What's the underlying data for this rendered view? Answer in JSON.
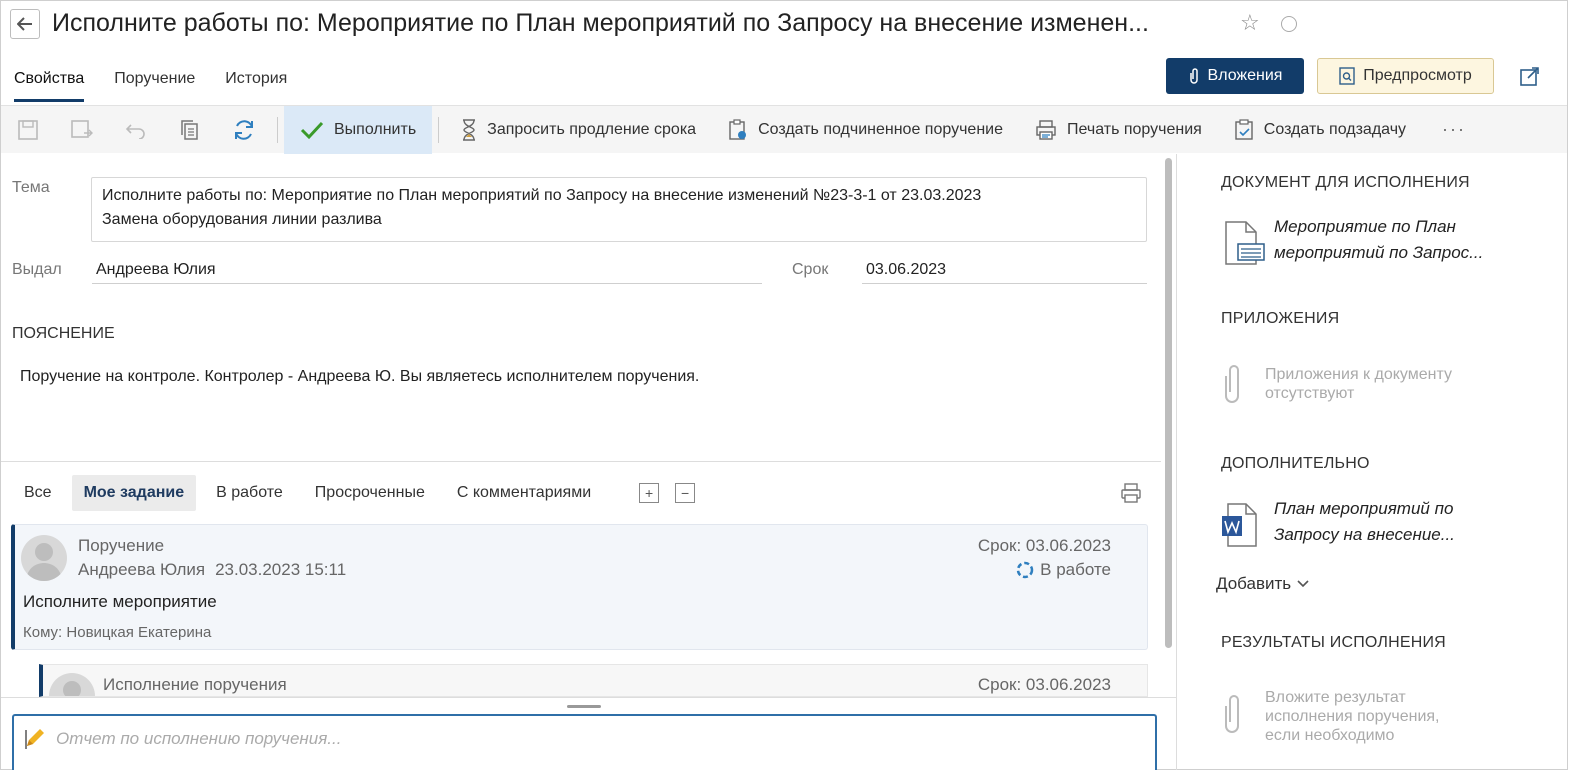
{
  "window": {
    "title": "Исполните работы по: Мероприятие по План мероприятий по Запросу на внесение изменен..."
  },
  "tabs": [
    {
      "label": "Свойства",
      "active": true
    },
    {
      "label": "Поручение",
      "active": false
    },
    {
      "label": "История",
      "active": false
    }
  ],
  "header_buttons": {
    "attachments": "Вложения",
    "preview": "Предпросмотр"
  },
  "toolbar": {
    "execute": "Выполнить",
    "request_extension": "Запросить продление срока",
    "create_sub_assignment": "Создать подчиненное поручение",
    "print_assignment": "Печать поручения",
    "create_subtask": "Создать подзадачу",
    "more": "···"
  },
  "form": {
    "theme_label": "Тема",
    "theme_line1": "Исполните работы по: Мероприятие по План мероприятий по Запросу на внесение изменений №23-3-1 от 23.03.2023",
    "theme_line2": "Замена оборудования линии разлива",
    "issued_label": "Выдал",
    "issued_value": "Андреева Юлия",
    "deadline_label": "Срок",
    "deadline_value": "03.06.2023",
    "explanation_header": "ПОЯСНЕНИЕ",
    "explanation_text": "Поручение на контроле. Контролер - Андреева Ю. Вы являетесь исполнителем поручения."
  },
  "filters": [
    {
      "label": "Все",
      "active": false
    },
    {
      "label": "Мое задание",
      "active": true
    },
    {
      "label": "В работе",
      "active": false
    },
    {
      "label": "Просроченные",
      "active": false
    },
    {
      "label": "С комментариями",
      "active": false
    }
  ],
  "expand_symbols": {
    "plus": "+",
    "minus": "−"
  },
  "cards": [
    {
      "type": "Поручение",
      "author": "Андреева Юлия",
      "date": "23.03.2023 15:11",
      "due": "Срок: 03.06.2023",
      "status": "В работе",
      "text": "Исполните мероприятие",
      "to": "Кому: Новицкая Екатерина"
    },
    {
      "type": "Исполнение поручения",
      "due": "Срок: 03.06.2023"
    }
  ],
  "report": {
    "placeholder": "Отчет по исполнению поручения..."
  },
  "right_panel": {
    "doc_header": "ДОКУМЕНТ ДЛЯ ИСПОЛНЕНИЯ",
    "doc_line1": "Мероприятие по План",
    "doc_line2": "мероприятий по Запрос...",
    "attachments_header": "ПРИЛОЖЕНИЯ",
    "attachments_empty_1": "Приложения к документу",
    "attachments_empty_2": "отсутствуют",
    "additional_header": "ДОПОЛНИТЕЛЬНО",
    "additional_line1": "План мероприятий по",
    "additional_line2": "Запросу на внесение...",
    "add_label": "Добавить",
    "results_header": "РЕЗУЛЬТАТЫ ИСПОЛНЕНИЯ",
    "results_empty_1": "Вложите результат",
    "results_empty_2": "исполнения поручения,",
    "results_empty_3": "если необходимо"
  },
  "colors": {
    "accent": "#123c69",
    "execute_bg": "#dbe9f7",
    "preview_bg": "#fdf6e0"
  }
}
